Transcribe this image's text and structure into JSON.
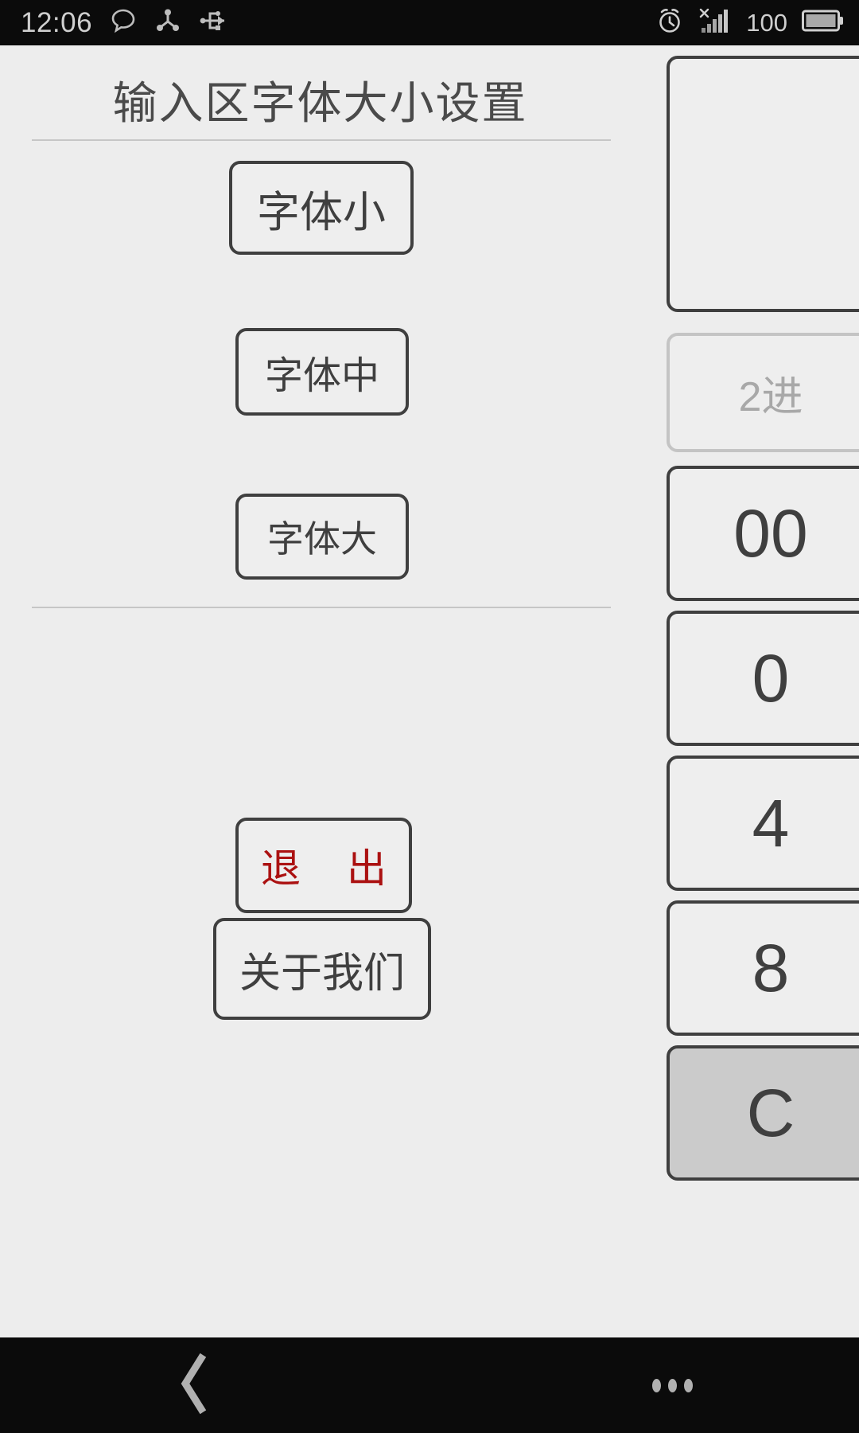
{
  "status_bar": {
    "time": "12:06",
    "battery_percent": "100",
    "icons": [
      {
        "name": "speech-bubble-icon"
      },
      {
        "name": "share-nodes-icon"
      },
      {
        "name": "usb-icon"
      },
      {
        "name": "alarm-clock-icon"
      },
      {
        "name": "signal-no-sim-icon"
      },
      {
        "name": "battery-icon"
      }
    ]
  },
  "panel": {
    "title": "输入区字体大小设置",
    "buttons": [
      {
        "label": "字体小",
        "name": "font-size-small-button"
      },
      {
        "label": "字体中",
        "name": "font-size-medium-button"
      },
      {
        "label": "字体大",
        "name": "font-size-large-button"
      }
    ],
    "exit_button": {
      "label": "退 出",
      "color": "#ab1111"
    },
    "about_button": {
      "label": "关于我们"
    }
  },
  "calculator": {
    "keys": [
      {
        "label": "",
        "name": "calc-display",
        "state": "empty"
      },
      {
        "label": "2进",
        "name": "calc-base2-button",
        "state": "disabled"
      },
      {
        "label": "00",
        "name": "calc-double-zero-button",
        "state": "normal"
      },
      {
        "label": "0",
        "name": "calc-zero-button",
        "state": "normal"
      },
      {
        "label": "4",
        "name": "calc-four-button",
        "state": "normal"
      },
      {
        "label": "8",
        "name": "calc-eight-button",
        "state": "normal"
      },
      {
        "label": "C",
        "name": "calc-clear-button",
        "state": "pressed"
      }
    ]
  },
  "nav_bar": {
    "back_label": "back-icon",
    "menu_label": "overflow-menu-icon"
  },
  "colors": {
    "background": "#ededed",
    "border": "#3f3f3f",
    "text": "#3f3f3f",
    "accent_red": "#ab1111",
    "status_bg": "#0b0b0b"
  }
}
